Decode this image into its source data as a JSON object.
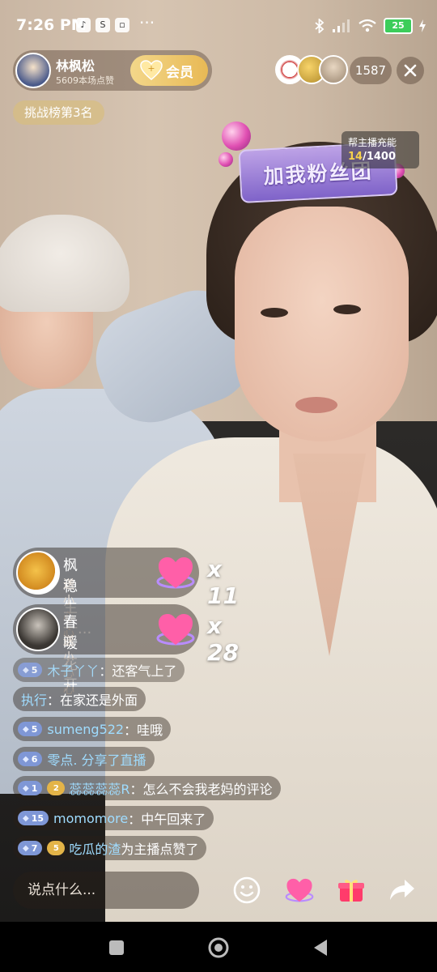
{
  "status_bar": {
    "time": "7:26 PM",
    "battery": "25",
    "more": "···"
  },
  "host": {
    "name": "林枫松",
    "likes": "5609本场点赞",
    "vip_label": "会员"
  },
  "viewers": {
    "count": "1587"
  },
  "rank_badge": "挑战榜第3名",
  "fan_club": {
    "sign_text": "加我粉丝团",
    "charge_label": "帮主播充能",
    "charge_current": "14",
    "charge_total": "/1400"
  },
  "gifts": [
    {
      "name": "枫稳生一...",
      "desc": "送小心心",
      "count": "x 11"
    },
    {
      "name": "春暖花开",
      "desc": "送小心心",
      "count": "x 28"
    }
  ],
  "chat": [
    {
      "level": "5",
      "user": "木子丫丫",
      "sep": "：",
      "message": "还客气上了"
    },
    {
      "level": "",
      "user": "执行",
      "sep": "：",
      "message": "在家还是外面"
    },
    {
      "level": "5",
      "user": "sumeng522",
      "sep": "：",
      "message": "哇哦"
    },
    {
      "level": "6",
      "user": "零点. 分享了直播",
      "sep": "",
      "message": ""
    },
    {
      "level": "1",
      "fan_level": "2",
      "user": "蕊蕊蕊蕊R",
      "sep": "：",
      "message": "怎么不会我老妈的评论"
    },
    {
      "level": "15",
      "user": "momomore",
      "sep": "：",
      "message": "中午回来了"
    },
    {
      "level": "7",
      "fan_level": "5",
      "user": "吃瓜的渣",
      "sep": " ",
      "message": "为主播点赞了"
    }
  ],
  "input": {
    "placeholder": "说点什么..."
  },
  "icons": [
    "emoji-icon",
    "heart-icon",
    "gift-icon",
    "share-icon"
  ],
  "colors": {
    "chat_user": "#9fdcff",
    "vip_gold": "#e8b955",
    "charge_current": "#f6d24b"
  }
}
